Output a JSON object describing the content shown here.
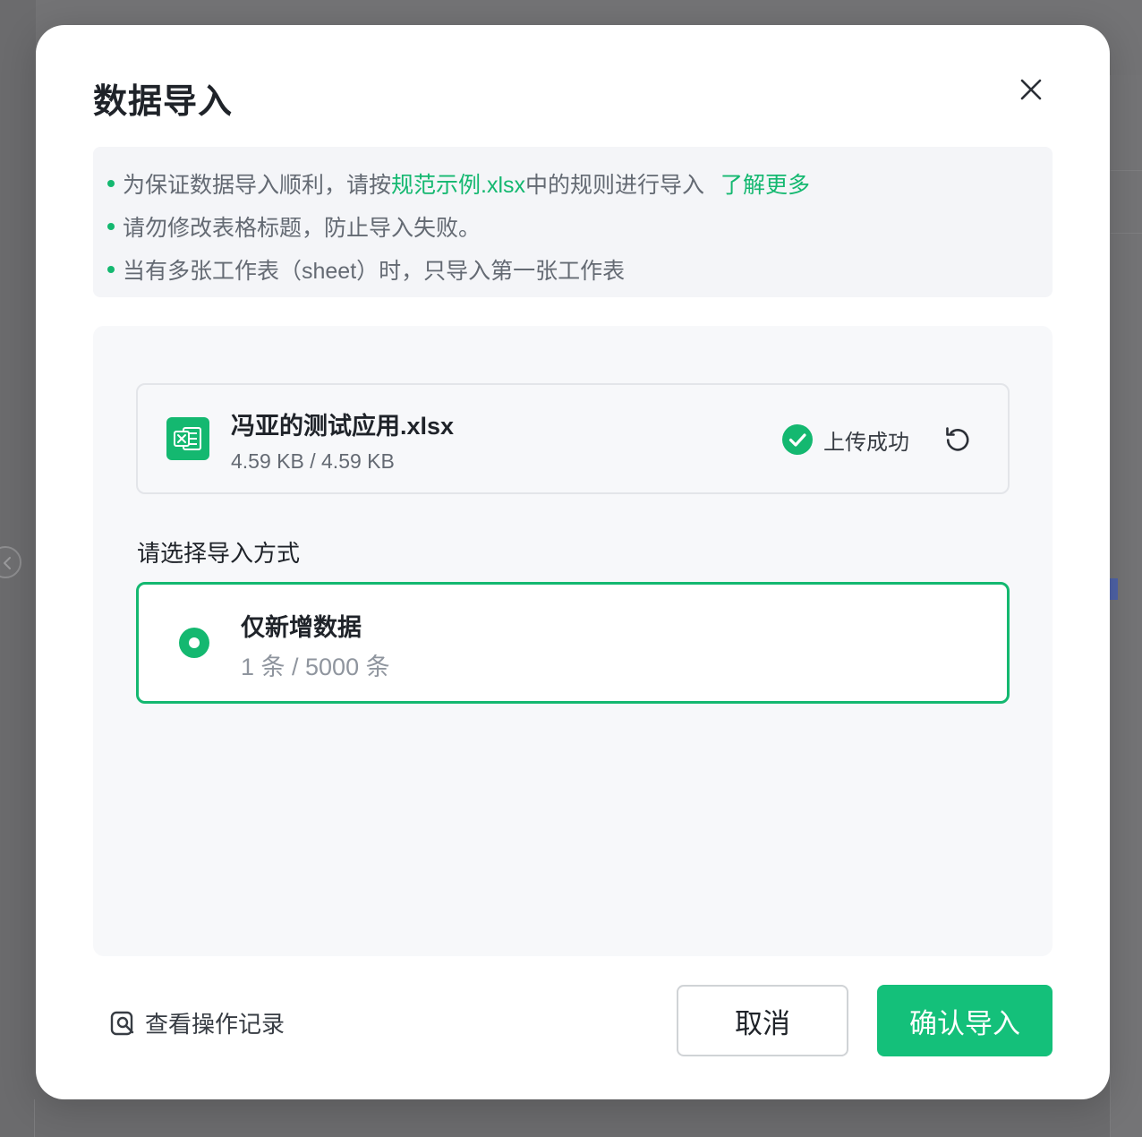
{
  "modal": {
    "title": "数据导入",
    "close_icon": "close-icon"
  },
  "tips": [
    {
      "before": "为保证数据导入顺利，请按 ",
      "link": "规范示例.xlsx",
      "after": " 中的规则进行导入",
      "more": "了解更多"
    },
    {
      "text": "请勿修改表格标题，防止导入失败。"
    },
    {
      "text": "当有多张工作表（sheet）时，只导入第一张工作表"
    }
  ],
  "file": {
    "icon": "excel-file-icon",
    "name": "冯亚的测试应用.xlsx",
    "size": "4.59 KB / 4.59 KB",
    "status": "上传成功",
    "status_icon": "check-circle-icon",
    "retry_icon": "refresh-icon"
  },
  "import": {
    "method_label": "请选择导入方式",
    "options": [
      {
        "title": "仅新增数据",
        "count": "1 条 / 5000 条",
        "selected": true
      }
    ]
  },
  "footer": {
    "history_label": "查看操作记录",
    "history_icon": "search-record-icon",
    "cancel_label": "取消",
    "confirm_label": "确认导入"
  },
  "colors": {
    "accent": "#14b870",
    "confirm_button": "#14c07a",
    "overlay": "#6f6f71"
  }
}
